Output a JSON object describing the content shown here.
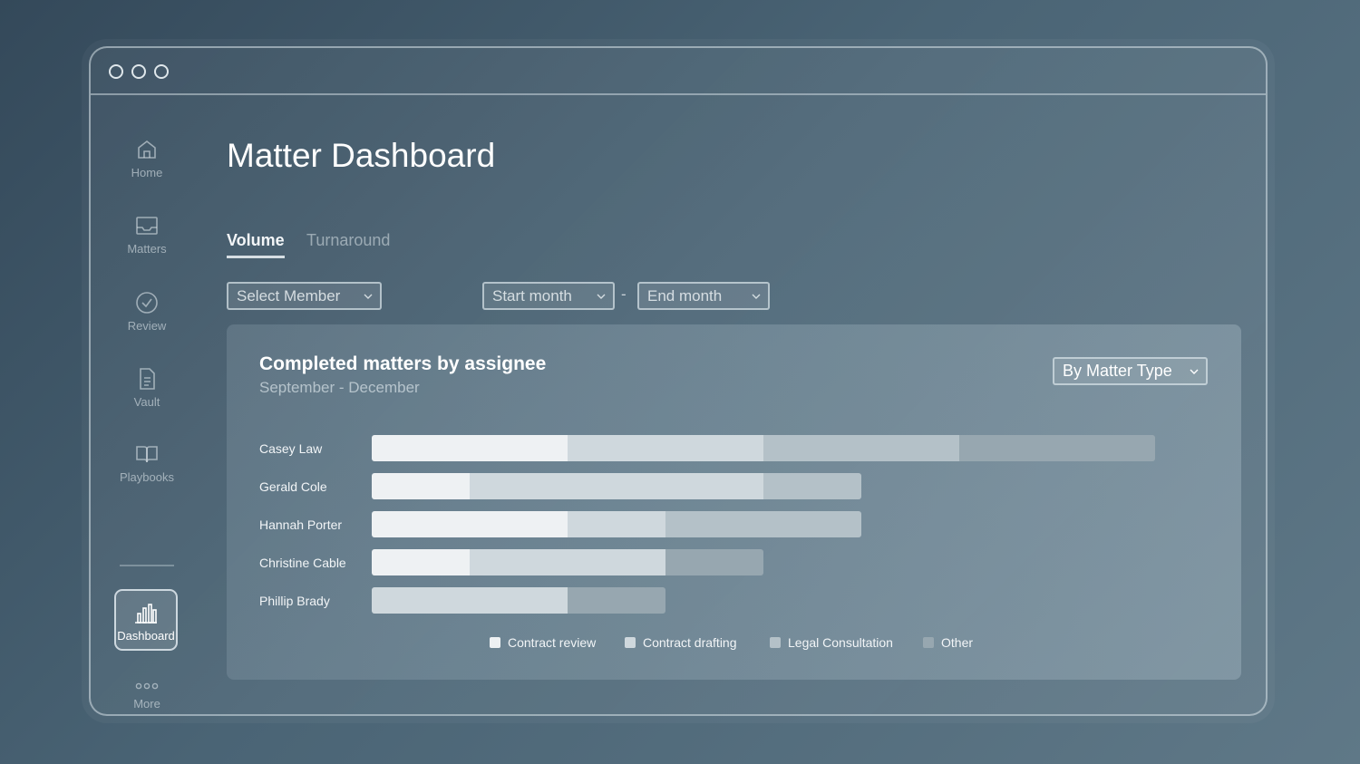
{
  "sidebar": {
    "items": [
      {
        "label": "Home",
        "icon": "home-icon"
      },
      {
        "label": "Matters",
        "icon": "inbox-icon"
      },
      {
        "label": "Review",
        "icon": "check-circle-icon"
      },
      {
        "label": "Vault",
        "icon": "document-icon"
      },
      {
        "label": "Playbooks",
        "icon": "book-icon"
      },
      {
        "label": "Dashboard",
        "icon": "bar-chart-icon",
        "active": true
      },
      {
        "label": "More",
        "icon": "more-dots-icon"
      }
    ]
  },
  "page": {
    "title": "Matter Dashboard"
  },
  "tabs": [
    {
      "label": "Volume",
      "active": true
    },
    {
      "label": "Turnaround",
      "active": false
    }
  ],
  "filters": {
    "member": "Select Member",
    "start_month": "Start month",
    "separator": "-",
    "end_month": "End month"
  },
  "card": {
    "title": "Completed matters by assignee",
    "subtitle": "September - December",
    "group_by": "By Matter Type"
  },
  "colors": {
    "contract_review": "#eef1f3",
    "contract_drafting": "#cfd8dd",
    "legal_consultation": "#b4c1c8",
    "other": "#97a7b0"
  },
  "chart_data": {
    "type": "bar",
    "orientation": "horizontal",
    "stacked": true,
    "categories": [
      "Casey Law",
      "Gerald Cole",
      "Hannah Porter",
      "Christine Cable",
      "Phillip Brady"
    ],
    "series": [
      {
        "name": "Contract review",
        "values": [
          2,
          1,
          2,
          1,
          0
        ]
      },
      {
        "name": "Contract drafting",
        "values": [
          2,
          3,
          1,
          2,
          2
        ]
      },
      {
        "name": "Legal Consultation",
        "values": [
          2,
          1,
          2,
          0,
          0
        ]
      },
      {
        "name": "Other",
        "values": [
          2,
          0,
          0,
          1,
          1
        ]
      }
    ],
    "legend": "bottom",
    "grid": false
  }
}
